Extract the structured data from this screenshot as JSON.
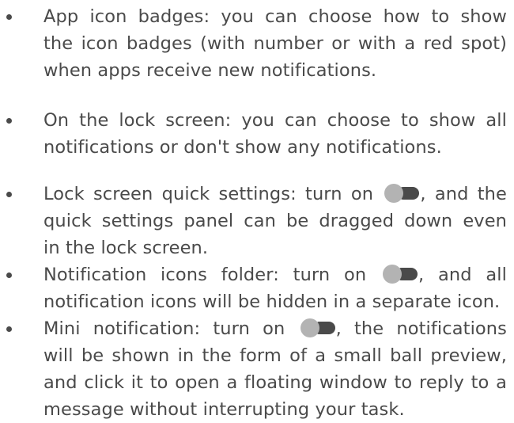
{
  "toggle_icon": {
    "name": "toggle-off-icon",
    "knob_color": "#b3b3b3",
    "track_color": "#4a4a4a"
  },
  "text_color": "#4a4a4a",
  "items": [
    {
      "lines": [
        "App icon badges: you can choose how to show",
        "the icon badges (with number or with a red spot)",
        "when apps receive new notifications."
      ]
    },
    {
      "lines": [
        "On the lock screen: you can choose to show all",
        "notifications or don't show any notifications."
      ]
    },
    {
      "line1_before": "Lock screen quick settings: turn on",
      "line1_after": ", and the",
      "lines": [
        "quick settings panel can be dragged down even",
        "in the lock screen."
      ]
    },
    {
      "line1_before": "Notification icons folder: turn on",
      "line1_after": ", and all",
      "lines": [
        "notification icons will be hidden in a separate icon."
      ]
    },
    {
      "line1_before": "Mini notification: turn on",
      "line1_after": ", the notifications",
      "lines": [
        "will be shown in the form of a small ball preview,",
        "and click it to open a floating window to reply to a",
        "message  without interrupting your task."
      ]
    }
  ]
}
